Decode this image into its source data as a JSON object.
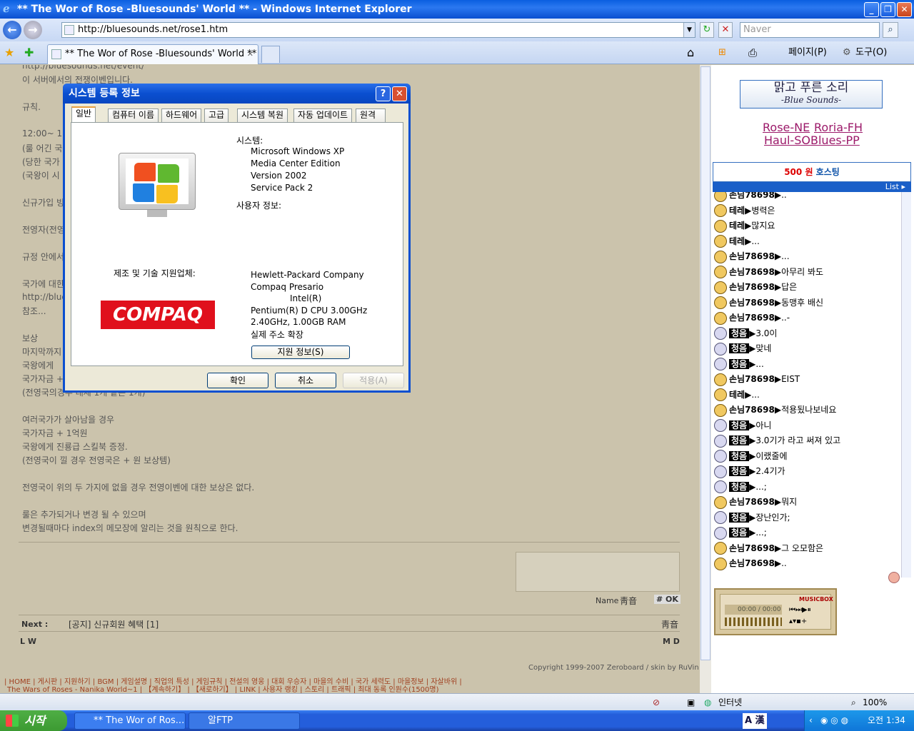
{
  "window": {
    "title": "** The Wor of Rose -Bluesounds' World ** - Windows Internet Explorer",
    "minimize": "_",
    "maximize": "❐",
    "close": "✕"
  },
  "nav": {
    "back": "←",
    "forward": "→",
    "url": "http://bluesounds.net/rose1.htm",
    "refresh": "↻",
    "stop": "✕",
    "search_placeholder": "Naver",
    "search_btn": "⌕"
  },
  "tabs": {
    "active": "** The Wor of Rose -Bluesounds' World **"
  },
  "commands": {
    "home": "⌂",
    "feeds": "⊞",
    "print": "⎙",
    "page": "페이지(P)",
    "tools": "도구(O)"
  },
  "page": {
    "lines": [
      "http://bluesounds.net/event/",
      "이 서버에서의 전쟁이벤입니다.",
      "규칙.",
      "12:00~ 18",
      "(룰 어긴 국",
      "(당한 국가",
      "(국왕이 시",
      "신규가입 빙",
      "전영자(전영",
      "규정 안에서",
      "국가에 대한",
      "http://blue",
      "참조...",
      "보상",
      "마지막까지",
      "국왕에게 ",
      "국가자금 +",
      "(전영국의경우 대체 1개 같은 1개)",
      "여러국가가 살아남을 경우",
      "국가자금 + 1억원",
      "국왕에게 진룡급 스킬북 증정.",
      "(전영국이 낄 경우 전영국은 + 원 보상템)",
      "전영국이 위의 두 가지에 없을 경우 전영이벤에 대한 보상은 없다.",
      "룰은 추가되거나 변경 될 수 있으며",
      "변경될때마다 index의 메모장에 알리는 것을 원칙으로 한다."
    ],
    "name_label": "Name",
    "name_value": "靑音",
    "ok_btn": "# OK",
    "next_label": "Next :",
    "next_text": "[공지] 신규회원 혜택 [1]",
    "next_author": "靑音",
    "lw": "L W",
    "md": "M D",
    "copyright": "Copyright 1999-2007 Zeroboard / skin by RuVin",
    "menu1": "| HOME | 게시판 | 지원하기 | BGM | 게임설명 | 직업의 특성 | 게임규칙 | 전설의 영웅 | 대회 우승자 | 마을의 수비 | 국가 세력도 | 마을정보 | 자살바위 |",
    "menu2": "The Wars of Roses - Nanika World~1 | 【계속하기】 | 【새로하기】 | LINK | 사용자 랭킹 | 스토리 | 트래픽 | 최대 동록 인원수(1500명)"
  },
  "right": {
    "logo": "맑고 푸른 소리",
    "logo_sub": "-Blue Sounds-",
    "links": [
      "Rose-NE",
      "Roria-FH",
      "Haul-SO",
      "Blues-PP"
    ],
    "hosting_num": "500",
    "hosting_unit": "원",
    "hosting_text": "호스팅",
    "list": "List ▸",
    "chat": [
      {
        "n": "손님78698",
        "m": "▶..",
        "i": false
      },
      {
        "n": "테레",
        "m": "▶병력은",
        "i": false
      },
      {
        "n": "테레",
        "m": "▶많지요",
        "i": false
      },
      {
        "n": "테레",
        "m": "▶...",
        "i": false
      },
      {
        "n": "손님78698",
        "m": "▶...",
        "i": false
      },
      {
        "n": "손님78698",
        "m": "▶아무리 봐도",
        "i": false
      },
      {
        "n": "손님78698",
        "m": "▶답은",
        "i": false
      },
      {
        "n": "손님78698",
        "m": "▶동맹후 배신",
        "i": false
      },
      {
        "n": "손님78698",
        "m": "▶..-",
        "i": false
      },
      {
        "n": "청음",
        "m": "▶3.0이",
        "i": true
      },
      {
        "n": "청음",
        "m": "▶맞네",
        "i": true
      },
      {
        "n": "청음",
        "m": "▶...",
        "i": true
      },
      {
        "n": "손님78698",
        "m": "▶EIST",
        "i": false
      },
      {
        "n": "테레",
        "m": "▶...",
        "i": false
      },
      {
        "n": "손님78698",
        "m": "▶적용됬나보네요",
        "i": false
      },
      {
        "n": "청음",
        "m": "▶아니",
        "i": true
      },
      {
        "n": "청음",
        "m": "▶3.0기가 라고 써져 있고",
        "i": true
      },
      {
        "n": "청음",
        "m": "▶이랬줄에",
        "i": true
      },
      {
        "n": "청음",
        "m": "▶2.4기가",
        "i": true
      },
      {
        "n": "청음",
        "m": "▶...;",
        "i": true
      },
      {
        "n": "손님78698",
        "m": "▶뭐지",
        "i": false
      },
      {
        "n": "청음",
        "m": "▶장난인가;",
        "i": true
      },
      {
        "n": "청음",
        "m": "▶...;",
        "i": true
      },
      {
        "n": "손님78698",
        "m": "▶그 오모함은",
        "i": false
      },
      {
        "n": "손님78698",
        "m": "▶..",
        "i": false
      }
    ],
    "music_brand": "MUSICBOX",
    "music_time": "00:00 / 00:00"
  },
  "dialog": {
    "title": "시스템 등록 정보",
    "help": "?",
    "close": "✕",
    "tabs": [
      "일반",
      "컴퓨터 이름",
      "하드웨어",
      "고급",
      "시스템 복원",
      "자동 업데이트",
      "원격"
    ],
    "system_label": "시스템:",
    "sys1": "Microsoft Windows XP",
    "sys2": "Media Center Edition",
    "sys3": "Version 2002",
    "sys4": "Service Pack 2",
    "user_label": "사용자 정보:",
    "mfr_label": "제조 및 기술 지원업체:",
    "oem_logo": "COMPAQ",
    "m1": "Hewlett-Packard Company",
    "m2": "Compaq Presario",
    "m3": "Intel(R)",
    "m4": "Pentium(R) D CPU 3.00GHz",
    "m5": "2.40GHz, 1.00GB RAM",
    "m6": "실제 주소 확장",
    "support_btn": "지원 정보(S)",
    "ok": "확인",
    "cancel": "취소",
    "apply": "적용(A)"
  },
  "status": {
    "zone": "인터넷",
    "zoom": "100%"
  },
  "taskbar": {
    "start": "시작",
    "task1": "** The Wor of Ros...",
    "task2": "알FTP",
    "ime": "A 漢",
    "clock": "오전 1:34"
  }
}
